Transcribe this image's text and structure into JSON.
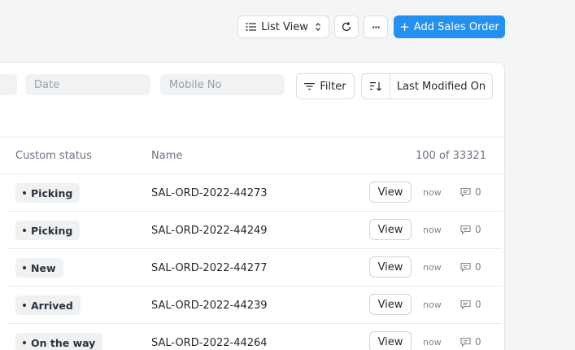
{
  "toolbar": {
    "list_view_label": "List View",
    "more_label": "···",
    "add_label": "Add Sales Order"
  },
  "filters": {
    "date_placeholder": "Date",
    "mobile_placeholder": "Mobile No",
    "filter_label": "Filter",
    "sort_label": "Last Modified On"
  },
  "table": {
    "headers": {
      "status": "Custom status",
      "name": "Name",
      "count": "100 of 33321"
    },
    "rows": [
      {
        "status": "Picking",
        "name": "SAL-ORD-2022-44273",
        "view": "View",
        "when": "now",
        "comments": "0"
      },
      {
        "status": "Picking",
        "name": "SAL-ORD-2022-44249",
        "view": "View",
        "when": "now",
        "comments": "0"
      },
      {
        "status": "New",
        "name": "SAL-ORD-2022-44277",
        "view": "View",
        "when": "now",
        "comments": "0"
      },
      {
        "status": "Arrived",
        "name": "SAL-ORD-2022-44239",
        "view": "View",
        "when": "now",
        "comments": "0"
      },
      {
        "status": "On the way",
        "name": "SAL-ORD-2022-44264",
        "view": "View",
        "when": "now",
        "comments": "0"
      }
    ]
  },
  "colors": {
    "accent": "#2490ef",
    "background": "#f4f5f6",
    "pill": "#f0f1f3"
  }
}
